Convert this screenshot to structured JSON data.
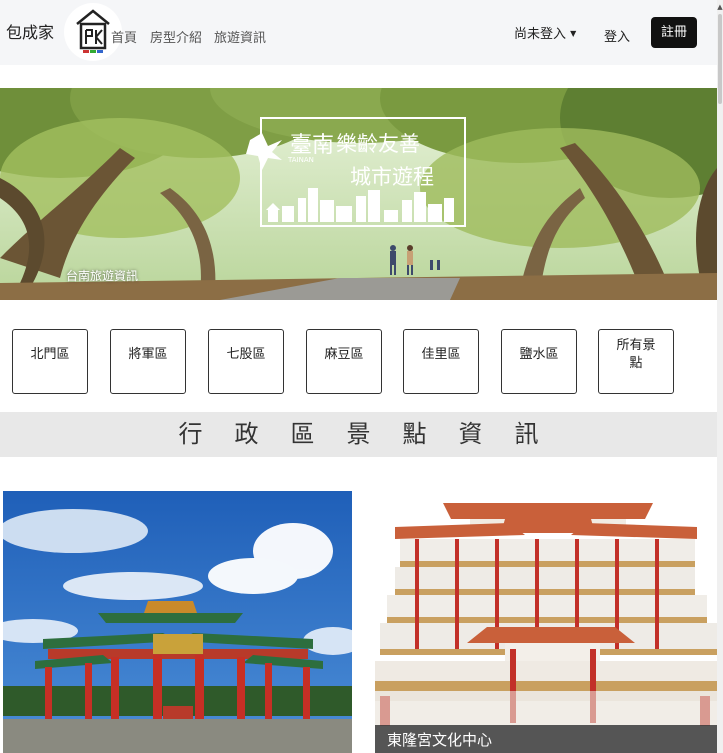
{
  "header": {
    "brand": "包成家",
    "logo": "house-logo",
    "nav": [
      "首頁",
      "房型介紹",
      "旅遊資訊"
    ],
    "user_status": "尚未登入",
    "login": "登入",
    "register": "註冊"
  },
  "hero": {
    "sign_title": "樂齡友善",
    "sign_subtitle": "城市遊程",
    "sign_brand": "臺南",
    "sign_brand_en": "TAINAN",
    "caption": "台南旅遊資訊"
  },
  "districts": [
    "北門區",
    "將軍區",
    "七股區",
    "麻豆區",
    "佳里區",
    "鹽水區",
    "所有景點"
  ],
  "section_title": "行政區景點資訊",
  "cards": [
    {
      "title": ""
    },
    {
      "title": "東隆宮文化中心"
    }
  ],
  "colors": {
    "navbar_bg": "#f5f6f8",
    "register_bg": "#111111",
    "band_bg": "#e8e8e8"
  }
}
